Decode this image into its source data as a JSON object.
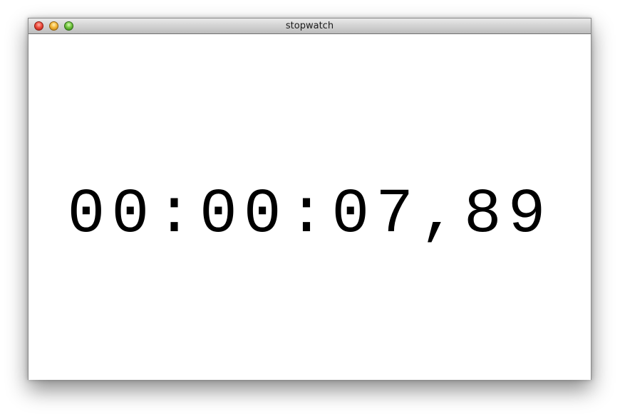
{
  "window": {
    "title": "stopwatch"
  },
  "stopwatch": {
    "time": "00:00:07,89"
  },
  "colors": {
    "close": "#ee4d3e",
    "minimize": "#f4b83a",
    "zoom": "#73c53f",
    "text": "#000000",
    "background": "#ffffff"
  }
}
